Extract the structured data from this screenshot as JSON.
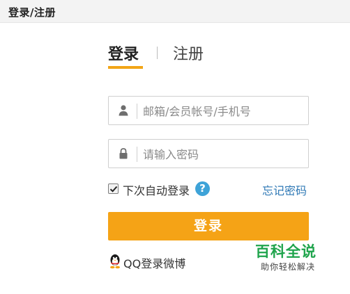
{
  "header": {
    "title": "登录/注册"
  },
  "tabs": {
    "login": "登录",
    "register": "注册"
  },
  "form": {
    "username": {
      "placeholder": "邮箱/会员帐号/手机号",
      "value": "",
      "icon": "user-icon"
    },
    "password": {
      "placeholder": "请输入密码",
      "value": "",
      "icon": "lock-icon"
    },
    "remember": {
      "label": "下次自动登录",
      "checked": true
    },
    "forgot_label": "忘记密码",
    "submit_label": "登录"
  },
  "qq_login": {
    "label": "QQ登录微博",
    "icon": "qq-penguin-icon"
  },
  "watermark": {
    "title": "百科全说",
    "subtitle": "助你轻松解决"
  },
  "colors": {
    "accent": "#f5a316",
    "link": "#2e78b5",
    "help_icon": "#3ea3d8",
    "watermark_green": "#1fa44c"
  }
}
